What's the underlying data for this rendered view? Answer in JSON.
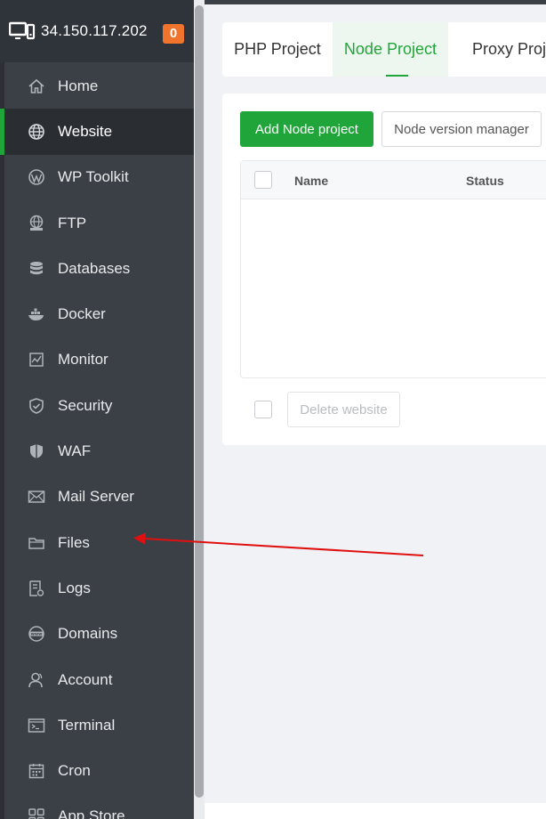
{
  "header": {
    "server_ip": "34.150.117.202",
    "notification_count": "0",
    "icon": "monitor-icon"
  },
  "sidebar": {
    "items": [
      {
        "label": "Home",
        "icon": "home-icon"
      },
      {
        "label": "Website",
        "icon": "globe-icon",
        "active": true
      },
      {
        "label": "WP Toolkit",
        "icon": "wordpress-icon"
      },
      {
        "label": "FTP",
        "icon": "ftp-icon"
      },
      {
        "label": "Databases",
        "icon": "database-icon"
      },
      {
        "label": "Docker",
        "icon": "docker-icon"
      },
      {
        "label": "Monitor",
        "icon": "monitor-chart-icon"
      },
      {
        "label": "Security",
        "icon": "shield-icon"
      },
      {
        "label": "WAF",
        "icon": "waf-shield-icon"
      },
      {
        "label": "Mail Server",
        "icon": "mail-icon"
      },
      {
        "label": "Files",
        "icon": "folder-icon"
      },
      {
        "label": "Logs",
        "icon": "logs-icon"
      },
      {
        "label": "Domains",
        "icon": "www-icon"
      },
      {
        "label": "Account",
        "icon": "user-icon"
      },
      {
        "label": "Terminal",
        "icon": "terminal-icon"
      },
      {
        "label": "Cron",
        "icon": "calendar-icon"
      },
      {
        "label": "App Store",
        "icon": "apps-icon"
      }
    ]
  },
  "tabs": [
    {
      "label": "PHP Project"
    },
    {
      "label": "Node Project",
      "active": true
    },
    {
      "label": "Proxy Project"
    }
  ],
  "toolbar": {
    "add_label": "Add Node project",
    "version_label": "Node version manager"
  },
  "table": {
    "columns": [
      "Name",
      "Status"
    ]
  },
  "footer": {
    "delete_label": "Delete website"
  },
  "colors": {
    "accent": "#20a53a",
    "sidebar_bg": "#3b4047",
    "badge": "#f0742b",
    "annotation_arrow": "#e01010"
  }
}
